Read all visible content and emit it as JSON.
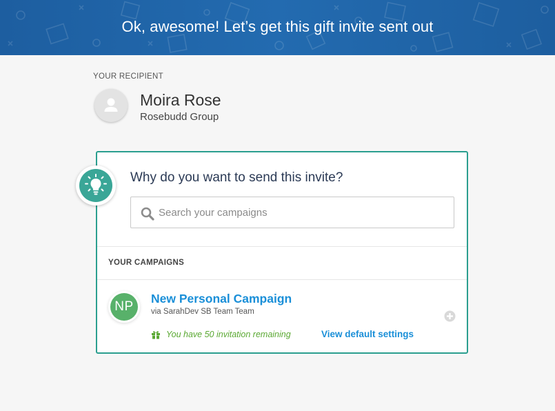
{
  "banner": {
    "title": "Ok, awesome! Let’s get this gift invite sent out",
    "color": "#1f63a6"
  },
  "recipient": {
    "heading": "YOUR RECIPIENT",
    "name": "Moira Rose",
    "company": "Rosebudd Group",
    "avatar_icon": "user-placeholder-icon"
  },
  "campaign_picker": {
    "question": "Why do you want to send this invite?",
    "icon": "lightbulb-icon",
    "accent_color": "#2a9e8f",
    "search": {
      "placeholder": "Search your campaigns",
      "value": "",
      "icon": "search-icon"
    },
    "campaigns_heading": "YOUR CAMPAIGNS",
    "campaigns": [
      {
        "initials": "NP",
        "name": "New Personal Campaign",
        "team": "via SarahDev SB Team Team",
        "invites_text": "You have 50 invitation remaining",
        "settings_link": "View default settings",
        "avatar_color": "#58b16a"
      }
    ]
  },
  "colors": {
    "link": "#1a8fd8",
    "success": "#5aa832"
  }
}
